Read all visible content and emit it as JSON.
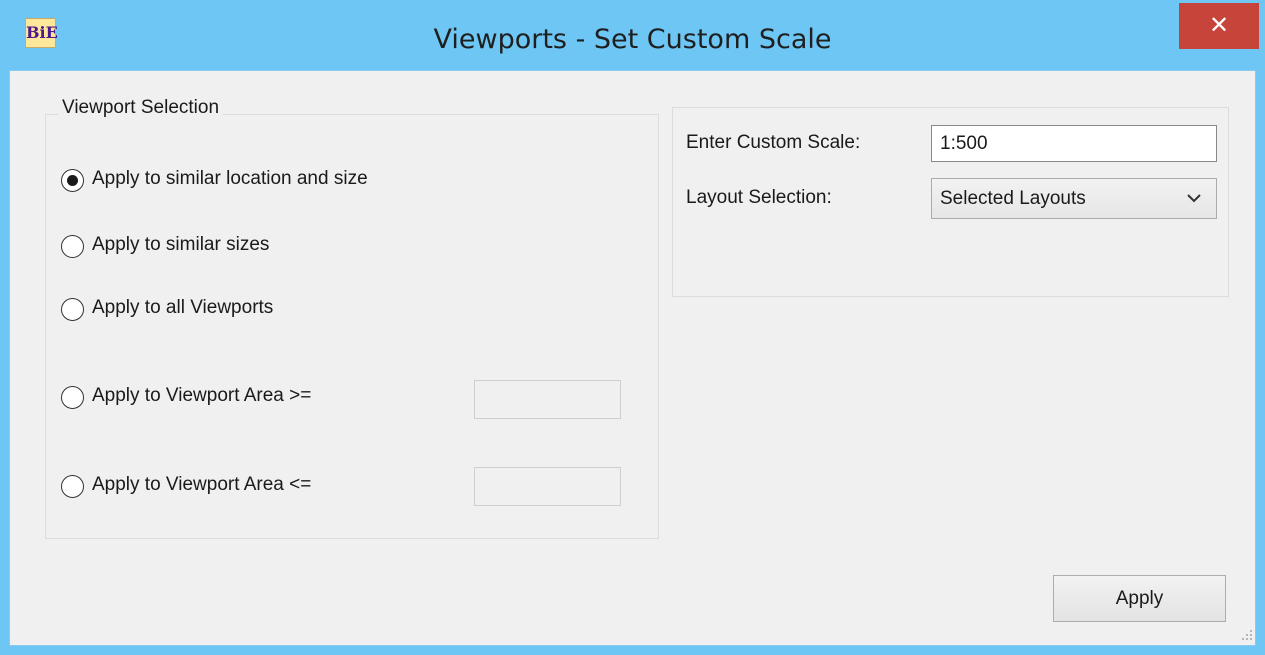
{
  "window": {
    "title": "Viewports - Set Custom Scale",
    "app_icon_text": "BiE",
    "close_label": "✕",
    "accent_color": "#6ec6f5",
    "close_color": "#c7443a"
  },
  "viewport_selection": {
    "legend": "Viewport Selection",
    "options": [
      {
        "label": "Apply to similar location and  size",
        "checked": true
      },
      {
        "label": "Apply to similar sizes",
        "checked": false
      },
      {
        "label": "Apply to all Viewports",
        "checked": false
      },
      {
        "label": "Apply to Viewport Area >=",
        "checked": false
      },
      {
        "label": "Apply to Viewport Area <=",
        "checked": false
      }
    ],
    "area_min_value": "",
    "area_max_value": ""
  },
  "scale": {
    "label": "Enter Custom Scale:",
    "value": "1:500"
  },
  "layout": {
    "label": "Layout Selection:",
    "selected": "Selected Layouts",
    "icon": "chevron-down-icon"
  },
  "actions": {
    "apply_label": "Apply"
  }
}
